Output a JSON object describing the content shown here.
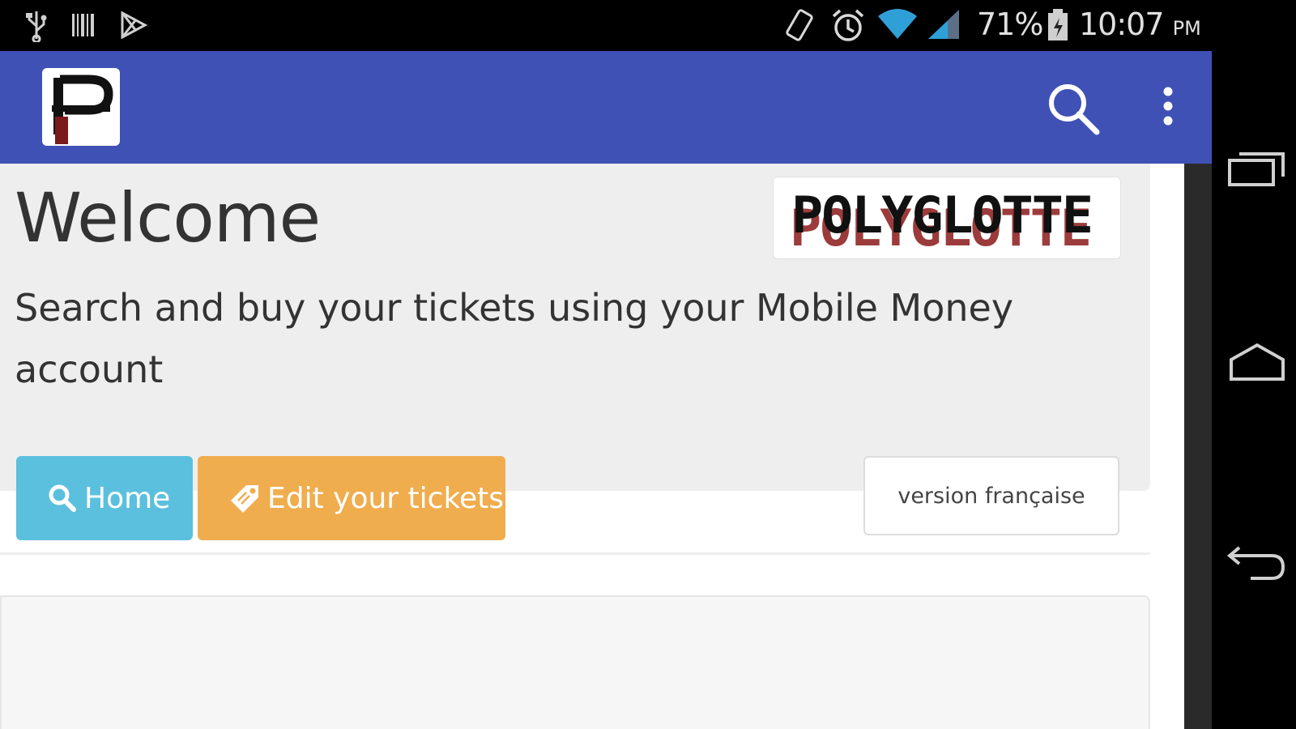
{
  "status_bar": {
    "battery": "71%",
    "time": "10:07",
    "ampm": "PM",
    "icons": [
      "usb-icon",
      "barcode-icon",
      "play-store-icon",
      "screen-rotation-icon",
      "alarm-icon",
      "wifi-icon",
      "signal-icon",
      "battery-icon"
    ]
  },
  "app_bar": {
    "background_color": "#3f51b5",
    "logo_icon": "app-logo-icon",
    "search_icon": "search-icon",
    "menu_icon": "overflow-menu-icon"
  },
  "main": {
    "welcome_title": "Welcome",
    "intro_text": "Search and buy your tickets using your Mobile Money account",
    "brand_logo_text": "POLYGLOTTE"
  },
  "footer": {
    "home_label": "Home",
    "edit_label": "Edit your tickets",
    "language_label": "version française",
    "home_color": "#5bc0de",
    "edit_color": "#f0ad4e"
  },
  "nav_bar": {
    "icons": [
      "recent-apps-icon",
      "home-icon",
      "back-icon"
    ]
  }
}
